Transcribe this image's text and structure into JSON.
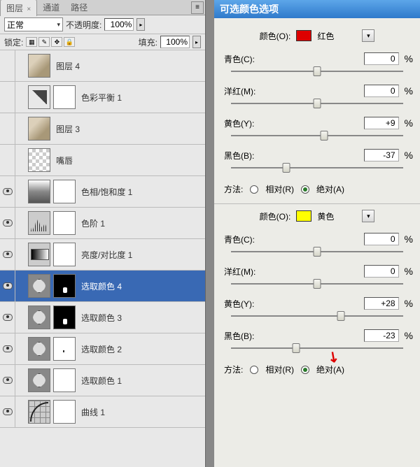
{
  "tabs": {
    "layers": "图层",
    "channels": "通道",
    "paths": "路径",
    "close_x": "×"
  },
  "blend": {
    "mode": "正常",
    "opacity_label": "不透明度:",
    "opacity": "100%"
  },
  "lock": {
    "label": "锁定:",
    "fill_label": "填充:",
    "fill": "100%"
  },
  "layers": [
    {
      "name": "图层 4",
      "eye": false,
      "thumbs": [
        "photo"
      ]
    },
    {
      "name": "色彩平衡 1",
      "eye": false,
      "thumbs": [
        "colorbal",
        "mask-white"
      ]
    },
    {
      "name": "图层 3",
      "eye": false,
      "thumbs": [
        "photo"
      ]
    },
    {
      "name": "嘴唇",
      "eye": false,
      "thumbs": [
        "checker"
      ]
    },
    {
      "name": "色相/饱和度 1",
      "eye": true,
      "thumbs": [
        "huesat",
        "mask-white"
      ]
    },
    {
      "name": "色阶 1",
      "eye": true,
      "thumbs": [
        "levels",
        "mask-white"
      ]
    },
    {
      "name": "亮度/对比度 1",
      "eye": true,
      "thumbs": [
        "bright",
        "mask-white"
      ]
    },
    {
      "name": "选取颜色 4",
      "eye": true,
      "thumbs": [
        "adjust",
        "mask-black-dot"
      ],
      "selected": true
    },
    {
      "name": "选取颜色 3",
      "eye": true,
      "thumbs": [
        "adjust",
        "mask-black-dot"
      ]
    },
    {
      "name": "选取颜色 2",
      "eye": true,
      "thumbs": [
        "adjust",
        "mask-tiny-dot"
      ]
    },
    {
      "name": "选取颜色 1",
      "eye": true,
      "thumbs": [
        "adjust",
        "mask-white"
      ]
    },
    {
      "name": "曲线 1",
      "eye": true,
      "thumbs": [
        "curves",
        "mask-white"
      ]
    }
  ],
  "options": {
    "title": "可选颜色选项",
    "color_label": "颜色(O):",
    "red_name": "红色",
    "yellow_name": "黄色",
    "sliders_labels": {
      "cyan": "青色(C):",
      "magenta": "洋红(M):",
      "yellow": "黄色(Y):",
      "black": "黑色(B):"
    },
    "pct": "%",
    "method_label": "方法:",
    "method_rel": "相对(R)",
    "method_abs": "绝对(A)",
    "group1": {
      "cyan": "0",
      "magenta": "0",
      "yellow": "+9",
      "black": "-37",
      "pos": {
        "cyan": 50,
        "magenta": 50,
        "yellow": 54,
        "black": 32
      }
    },
    "group2": {
      "cyan": "0",
      "magenta": "0",
      "yellow": "+28",
      "black": "-23",
      "pos": {
        "cyan": 50,
        "magenta": 50,
        "yellow": 64,
        "black": 38
      }
    }
  }
}
